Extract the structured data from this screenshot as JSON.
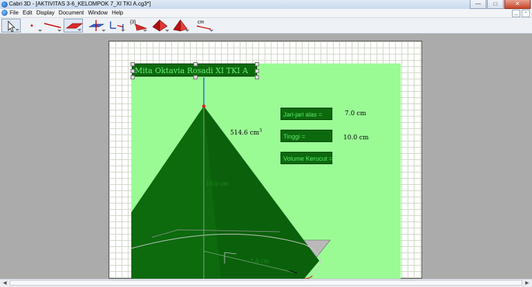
{
  "window": {
    "title": "Cabri 3D - [AKTIVITAS 3-6_KELOMPOK 7_XI TKI A.cg3*]",
    "controls": {
      "minimize": "—",
      "maximize": "□",
      "close": "✕"
    }
  },
  "menu": {
    "items": [
      "File",
      "Edit",
      "Display",
      "Document",
      "Window",
      "Help"
    ],
    "mdi": {
      "minimize": "_",
      "restore": "▫"
    }
  },
  "toolbar": {
    "tools": [
      {
        "name": "manipulation-tool",
        "active": true
      },
      {
        "name": "point-tool"
      },
      {
        "name": "line-tool"
      },
      {
        "name": "surface-tool",
        "active": true
      },
      {
        "name": "perpendicular-tool"
      },
      {
        "name": "transformation-tool"
      },
      {
        "name": "calculate-tool",
        "label": "{3}"
      },
      {
        "name": "polygon-tool"
      },
      {
        "name": "polyhedron-tool"
      },
      {
        "name": "pyramid-tool"
      },
      {
        "name": "measurement-tool",
        "label": "cm"
      }
    ]
  },
  "document": {
    "name_label": "Mita Oktavia Rosadi XI TKI A",
    "volume_measure": "514.6 cm",
    "volume_unit_exp": "3",
    "height_measure": "10.0 cm",
    "radius_measure": "7.0 cm",
    "fields": [
      {
        "label": "Jari-jari alas     =",
        "value": "7.0 cm"
      },
      {
        "label": "Tinggi               =",
        "value": "10.0 cm"
      },
      {
        "label": "Volume Kerucut =",
        "value": ""
      }
    ]
  },
  "colors": {
    "scene_bg": "#9afb95",
    "cone_dark": "#0a5e0a",
    "cone_light": "#178a17",
    "label_bg": "#0c6a0c",
    "label_text": "#6cf07a"
  },
  "scrollbar": {
    "left_arrow": "◀",
    "right_arrow": "▶"
  }
}
